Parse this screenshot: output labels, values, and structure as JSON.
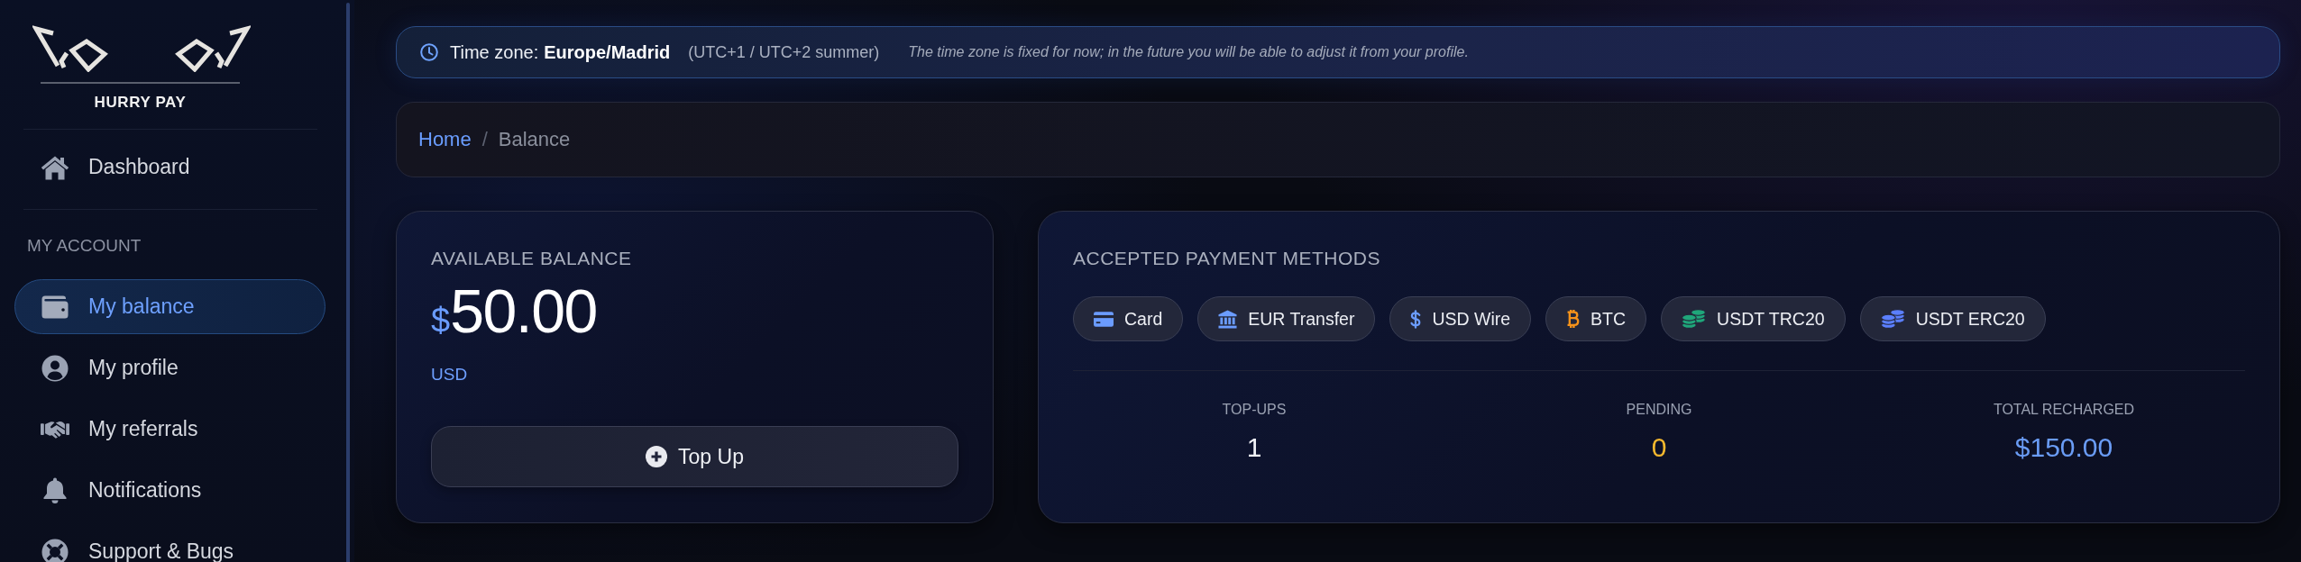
{
  "sidebar": {
    "brand": "HURRY PAY",
    "items": [
      {
        "label": "Dashboard",
        "selected": false
      }
    ],
    "sections": [
      {
        "heading": "MY ACCOUNT",
        "items": [
          {
            "label": "My balance",
            "selected": true
          },
          {
            "label": "My profile",
            "selected": false
          },
          {
            "label": "My referrals",
            "selected": false
          },
          {
            "label": "Notifications",
            "selected": false
          },
          {
            "label": "Support & Bugs",
            "selected": false
          }
        ]
      }
    ]
  },
  "timezone_banner": {
    "label": "Time zone:",
    "value": "Europe/Madrid",
    "offset": "(UTC+1 / UTC+2 summer)",
    "note": "The time zone is fixed for now; in the future you will be able to adjust it from your profile."
  },
  "breadcrumb": {
    "items": [
      {
        "label": "Home",
        "current": false
      },
      {
        "label": "Balance",
        "current": true
      }
    ],
    "separator": "/"
  },
  "balance_card": {
    "title": "AVAILABLE BALANCE",
    "currency_symbol": "$",
    "amount": "50.00",
    "currency": "USD",
    "button": "Top Up"
  },
  "payment_methods_card": {
    "title": "ACCEPTED PAYMENT METHODS",
    "methods": [
      {
        "label": "Card"
      },
      {
        "label": "EUR Transfer"
      },
      {
        "label": "USD Wire"
      },
      {
        "label": "BTC"
      },
      {
        "label": "USDT TRC20"
      },
      {
        "label": "USDT ERC20"
      }
    ],
    "stats": [
      {
        "label": "TOP-UPS",
        "value": "1",
        "color": "#f2f4f8"
      },
      {
        "label": "PENDING",
        "value": "0",
        "color": "#f5b82e"
      },
      {
        "label": "TOTAL RECHARGED",
        "value": "$150.00",
        "color": "#6a9cf5"
      }
    ]
  }
}
